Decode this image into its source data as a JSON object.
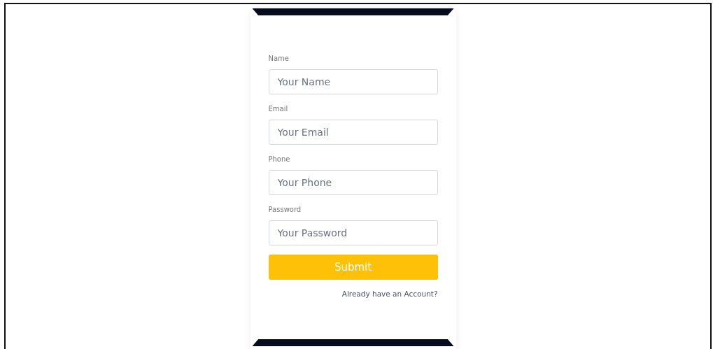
{
  "fields": [
    {
      "label": "Name",
      "placeholder": "Your Name"
    },
    {
      "label": "Email",
      "placeholder": "Your Email"
    },
    {
      "label": "Phone",
      "placeholder": "Your Phone"
    },
    {
      "label": "Password",
      "placeholder": "Your Password"
    }
  ],
  "submit": "Submit",
  "link": "Already have an Account?"
}
